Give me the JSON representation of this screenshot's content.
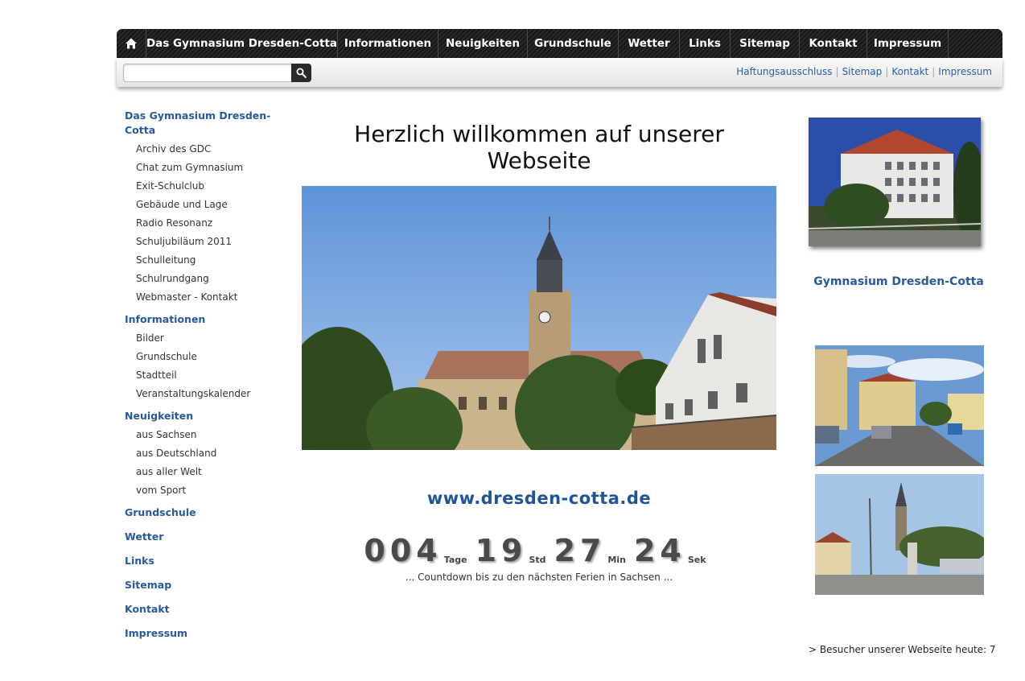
{
  "nav": {
    "home_icon": "home-icon",
    "items": [
      {
        "label": "Das Gymnasium Dresden-Cotta"
      },
      {
        "label": "Informationen"
      },
      {
        "label": "Neuigkeiten"
      },
      {
        "label": "Grundschule"
      },
      {
        "label": "Wetter"
      },
      {
        "label": "Links"
      },
      {
        "label": "Sitemap"
      },
      {
        "label": "Kontakt"
      },
      {
        "label": "Impressum"
      }
    ]
  },
  "search": {
    "placeholder": "",
    "value": "",
    "icon": "search-icon"
  },
  "top_links": [
    "Haftungsausschluss",
    "Sitemap",
    "Kontakt",
    "Impressum"
  ],
  "sidebar": {
    "groups": [
      {
        "title": "Das Gymnasium Dresden-Cotta",
        "items": [
          "Archiv des GDC",
          "Chat zum Gymnasium",
          "Exit-Schulclub",
          "Gebäude und Lage",
          "Radio Resonanz",
          "Schuljubiläum 2011",
          "Schulleitung",
          "Schulrundgang",
          "Webmaster - Kontakt"
        ]
      },
      {
        "title": "Informationen",
        "items": [
          "Bilder",
          "Grundschule",
          "Stadtteil",
          "Veranstaltungskalender"
        ]
      },
      {
        "title": "Neuigkeiten",
        "items": [
          "aus Sachsen",
          "aus Deutschland",
          "aus aller Welt",
          "vom Sport"
        ]
      },
      {
        "title": "Grundschule",
        "items": []
      },
      {
        "title": "Wetter",
        "items": []
      },
      {
        "title": "Links",
        "items": []
      },
      {
        "title": "Sitemap",
        "items": []
      },
      {
        "title": "Kontakt",
        "items": []
      },
      {
        "title": "Impressum",
        "items": []
      }
    ]
  },
  "main": {
    "title": "Herzlich willkommen auf unserer Webseite",
    "url_text": "www.dresden-cotta.de",
    "countdown": {
      "days": "004",
      "days_unit": "Tage",
      "hours": "19",
      "hours_unit": "Std",
      "minutes": "27",
      "minutes_unit": "Min",
      "seconds": "24",
      "seconds_unit": "Sek",
      "caption": "... Countdown bis zu den nächsten Ferien in Sachsen ..."
    }
  },
  "right": {
    "school_name": "Gymnasium Dresden-Cotta",
    "visitors": "> Besucher unserer Webseite heute: 7"
  },
  "colors": {
    "link_blue": "#275a9c",
    "nav_dark": "#1e1e1e",
    "url_blue": "#1f5497"
  }
}
